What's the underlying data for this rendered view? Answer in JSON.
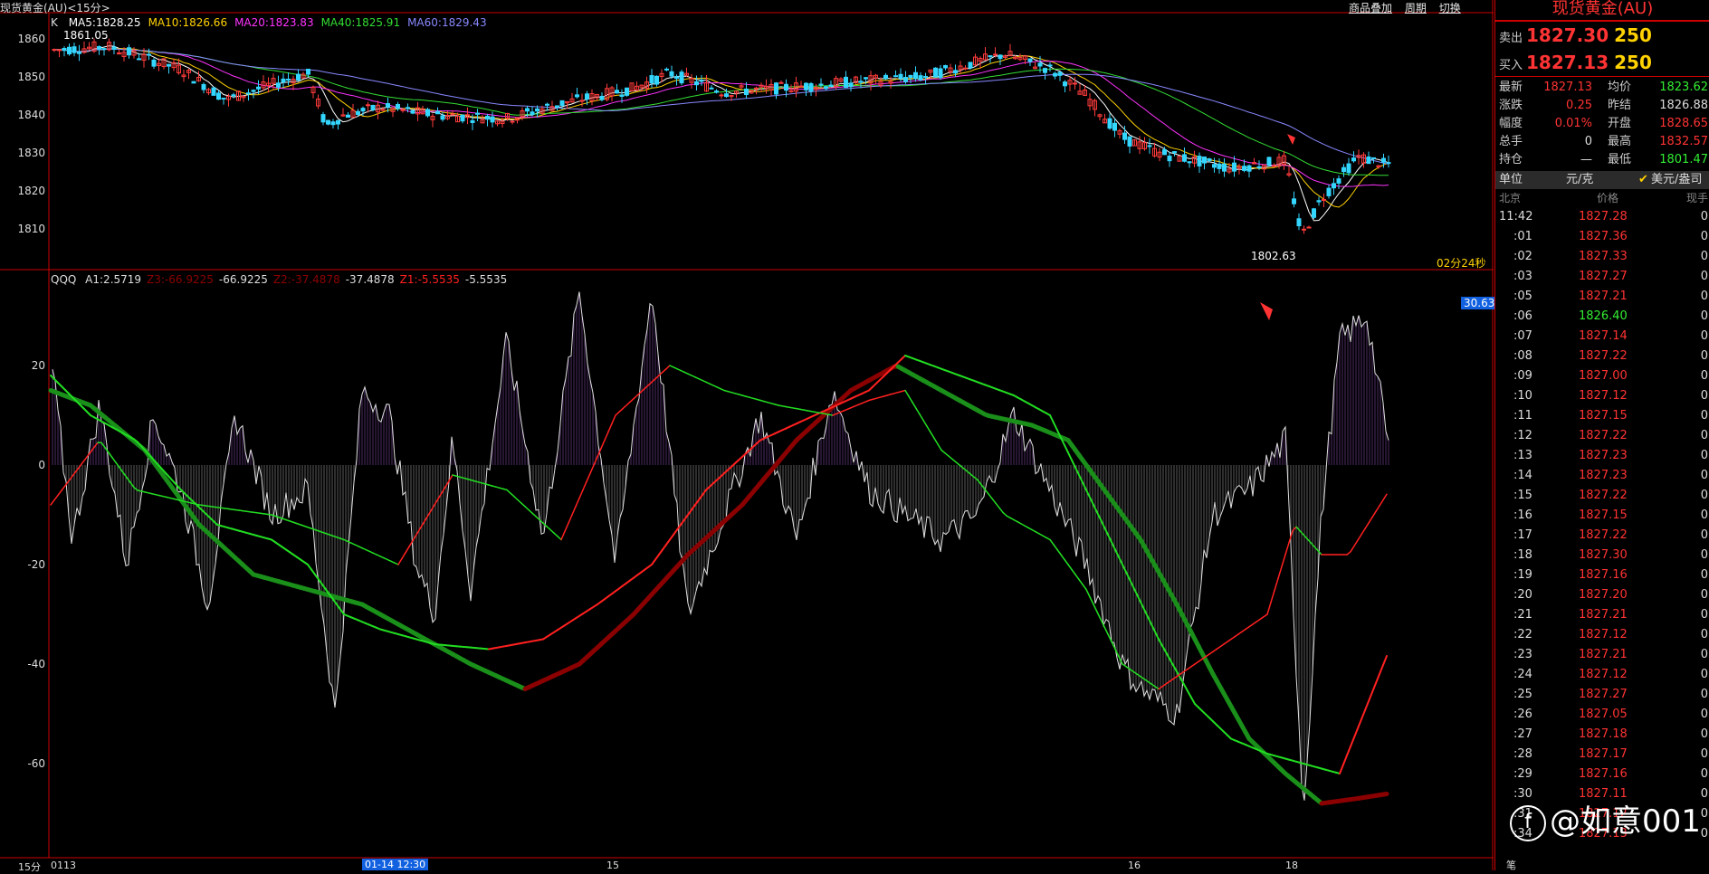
{
  "window": {
    "title": "现货黄金(AU)<15分>",
    "period": "15分"
  },
  "top_links": [
    "商品叠加",
    "周期",
    "切换"
  ],
  "main_chart": {
    "label_k": "K",
    "ma_items": [
      {
        "text": "MA5:1828.25",
        "color": "#ffffff"
      },
      {
        "text": "MA10:1826.66",
        "color": "#ffd200"
      },
      {
        "text": "MA20:1823.83",
        "color": "#ff33ff"
      },
      {
        "text": "MA40:1825.91",
        "color": "#33dd33"
      },
      {
        "text": "MA60:1829.43",
        "color": "#8888ff"
      }
    ],
    "y_ticks": [
      "1860",
      "1850",
      "1840",
      "1830",
      "1820",
      "1810"
    ],
    "high_label": "1861.05",
    "low_label": "1802.63",
    "countdown": "02分24秒"
  },
  "indicator": {
    "name": "QQQ",
    "items": [
      {
        "text": "A1:2.5719",
        "color": "#dddddd"
      },
      {
        "text": "Z3:-66.9225",
        "color": "#8b0000"
      },
      {
        "text": "-66.9225",
        "color": "#dddddd"
      },
      {
        "text": "Z2:-37.4878",
        "color": "#8b0000"
      },
      {
        "text": "-37.4878",
        "color": "#dddddd"
      },
      {
        "text": "Z1:-5.5535",
        "color": "#ff2020"
      },
      {
        "text": "-5.5535",
        "color": "#dddddd"
      }
    ],
    "y_ticks": [
      "20",
      "0",
      "-20",
      "-40",
      "-60"
    ],
    "value_badge": "30.63"
  },
  "x_axis": {
    "labels": [
      "0113",
      "01-14 12:30",
      "15",
      "16",
      "18"
    ]
  },
  "quote": {
    "title": "现货黄金(AU)",
    "sell_label": "卖出",
    "sell_price": "1827.30",
    "sell_vol": "250",
    "buy_label": "买入",
    "buy_price": "1827.13",
    "buy_vol": "250",
    "stats": [
      {
        "l1": "最新",
        "v1": "1827.13",
        "c1": "#ff3333",
        "l2": "均价",
        "v2": "1823.62",
        "c2": "#33ee33"
      },
      {
        "l1": "涨跌",
        "v1": "0.25",
        "c1": "#ff3333",
        "l2": "昨结",
        "v2": "1826.88",
        "c2": "#dddddd"
      },
      {
        "l1": "幅度",
        "v1": "0.01%",
        "c1": "#ff3333",
        "l2": "开盘",
        "v2": "1828.65",
        "c2": "#ff3333"
      },
      {
        "l1": "总手",
        "v1": "0",
        "c1": "#dddddd",
        "l2": "最高",
        "v2": "1832.57",
        "c2": "#ff3333"
      },
      {
        "l1": "持仓",
        "v1": "—",
        "c1": "#dddddd",
        "l2": "最低",
        "v2": "1801.47",
        "c2": "#33ee33"
      }
    ],
    "unit_label": "单位",
    "unit_value": "元/克",
    "unit_alt": "美元/盎司",
    "tick_headers": [
      "北京",
      "价格",
      "现手"
    ],
    "ticks": [
      {
        "t": "11:42",
        "p": "1827.28",
        "c": "#ff3333",
        "v": "0"
      },
      {
        "t": ":01",
        "p": "1827.36",
        "c": "#ff3333",
        "v": "0"
      },
      {
        "t": ":02",
        "p": "1827.33",
        "c": "#ff3333",
        "v": "0"
      },
      {
        "t": ":03",
        "p": "1827.27",
        "c": "#ff3333",
        "v": "0"
      },
      {
        "t": ":05",
        "p": "1827.21",
        "c": "#ff3333",
        "v": "0"
      },
      {
        "t": ":06",
        "p": "1826.40",
        "c": "#33ee33",
        "v": "0"
      },
      {
        "t": ":07",
        "p": "1827.14",
        "c": "#ff3333",
        "v": "0"
      },
      {
        "t": ":08",
        "p": "1827.22",
        "c": "#ff3333",
        "v": "0"
      },
      {
        "t": ":09",
        "p": "1827.00",
        "c": "#ff3333",
        "v": "0"
      },
      {
        "t": ":10",
        "p": "1827.12",
        "c": "#ff3333",
        "v": "0"
      },
      {
        "t": ":11",
        "p": "1827.15",
        "c": "#ff3333",
        "v": "0"
      },
      {
        "t": ":12",
        "p": "1827.22",
        "c": "#ff3333",
        "v": "0"
      },
      {
        "t": ":13",
        "p": "1827.23",
        "c": "#ff3333",
        "v": "0"
      },
      {
        "t": ":14",
        "p": "1827.23",
        "c": "#ff3333",
        "v": "0"
      },
      {
        "t": ":15",
        "p": "1827.22",
        "c": "#ff3333",
        "v": "0"
      },
      {
        "t": ":16",
        "p": "1827.15",
        "c": "#ff3333",
        "v": "0"
      },
      {
        "t": ":17",
        "p": "1827.22",
        "c": "#ff3333",
        "v": "0"
      },
      {
        "t": ":18",
        "p": "1827.30",
        "c": "#ff3333",
        "v": "0"
      },
      {
        "t": ":19",
        "p": "1827.16",
        "c": "#ff3333",
        "v": "0"
      },
      {
        "t": ":20",
        "p": "1827.20",
        "c": "#ff3333",
        "v": "0"
      },
      {
        "t": ":21",
        "p": "1827.21",
        "c": "#ff3333",
        "v": "0"
      },
      {
        "t": ":22",
        "p": "1827.12",
        "c": "#ff3333",
        "v": "0"
      },
      {
        "t": ":23",
        "p": "1827.21",
        "c": "#ff3333",
        "v": "0"
      },
      {
        "t": ":24",
        "p": "1827.12",
        "c": "#ff3333",
        "v": "0"
      },
      {
        "t": ":25",
        "p": "1827.27",
        "c": "#ff3333",
        "v": "0"
      },
      {
        "t": ":26",
        "p": "1827.05",
        "c": "#ff3333",
        "v": "0"
      },
      {
        "t": ":27",
        "p": "1827.18",
        "c": "#ff3333",
        "v": "0"
      },
      {
        "t": ":28",
        "p": "1827.17",
        "c": "#ff3333",
        "v": "0"
      },
      {
        "t": ":29",
        "p": "1827.16",
        "c": "#ff3333",
        "v": "0"
      },
      {
        "t": ":30",
        "p": "1827.11",
        "c": "#ff3333",
        "v": "0"
      },
      {
        "t": ":31",
        "p": "1827.12",
        "c": "#ff3333",
        "v": "0"
      },
      {
        "t": ":34",
        "p": "1827.13",
        "c": "#ff3333",
        "v": "0"
      }
    ],
    "footer_label": "笔"
  },
  "watermark": {
    "icon": "f",
    "text": "@如意001"
  }
}
